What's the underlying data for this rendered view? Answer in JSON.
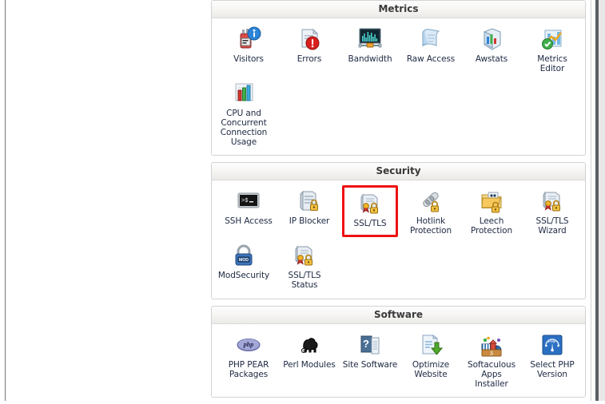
{
  "window": {
    "background_color": "#ffffff",
    "accent_highlight_color": "#ee1111",
    "label_text_color": "#202b44",
    "header_text_color": "#3a3a3a"
  },
  "sections": [
    {
      "title": "Metrics",
      "items": [
        {
          "label": "Visitors",
          "icon": "visitors-icon"
        },
        {
          "label": "Errors",
          "icon": "errors-icon"
        },
        {
          "label": "Bandwidth",
          "icon": "bandwidth-icon"
        },
        {
          "label": "Raw Access",
          "icon": "raw-access-icon"
        },
        {
          "label": "Awstats",
          "icon": "awstats-icon"
        },
        {
          "label": "Metrics\nEditor",
          "icon": "metrics-editor-icon"
        },
        {
          "label": "CPU and\nConcurrent\nConnection\nUsage",
          "icon": "cpu-usage-icon"
        }
      ]
    },
    {
      "title": "Security",
      "items": [
        {
          "label": "SSH Access",
          "icon": "ssh-access-icon"
        },
        {
          "label": "IP Blocker",
          "icon": "ip-blocker-icon"
        },
        {
          "label": "SSL/TLS",
          "icon": "ssl-tls-icon",
          "highlighted": true
        },
        {
          "label": "Hotlink\nProtection",
          "icon": "hotlink-protection-icon"
        },
        {
          "label": "Leech\nProtection",
          "icon": "leech-protection-icon"
        },
        {
          "label": "SSL/TLS\nWizard",
          "icon": "ssl-tls-wizard-icon"
        },
        {
          "label": "ModSecurity",
          "icon": "modsecurity-icon"
        },
        {
          "label": "SSL/TLS\nStatus",
          "icon": "ssl-tls-status-icon"
        }
      ]
    },
    {
      "title": "Software",
      "items": [
        {
          "label": "PHP PEAR\nPackages",
          "icon": "php-pear-icon"
        },
        {
          "label": "Perl Modules",
          "icon": "perl-modules-icon"
        },
        {
          "label": "Site Software",
          "icon": "site-software-icon"
        },
        {
          "label": "Optimize\nWebsite",
          "icon": "optimize-website-icon"
        },
        {
          "label": "Softaculous\nApps\nInstaller",
          "icon": "softaculous-icon"
        },
        {
          "label": "Select PHP\nVersion",
          "icon": "select-php-version-icon"
        }
      ]
    }
  ]
}
